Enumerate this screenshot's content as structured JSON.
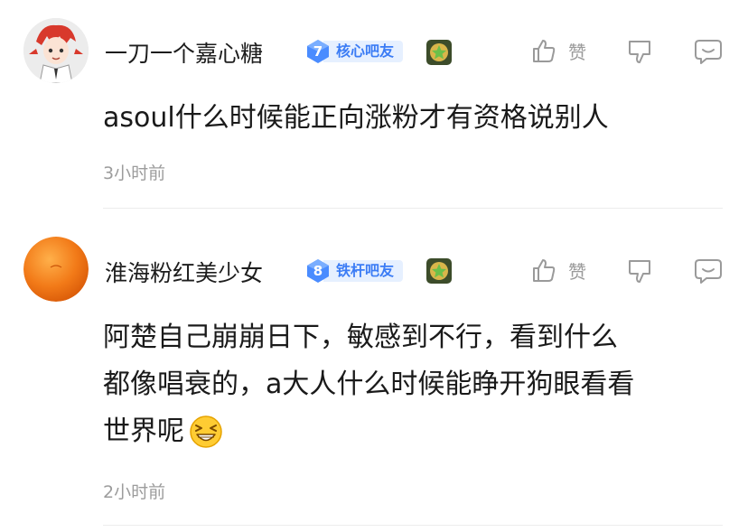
{
  "comments": [
    {
      "username": "一刀一个嘉心糖",
      "level": "7",
      "badge_title": "核心吧友",
      "text": "asoul什么时候能正向涨粉才有资格说别人",
      "time": "3小时前",
      "like_label": "赞"
    },
    {
      "username": "淮海粉红美少女",
      "level": "8",
      "badge_title": "铁杆吧友",
      "text_line1": "阿楚自己崩崩日下，敏感到不行，看到什么",
      "text_line2": "都像唱衰的，a大人什么时候能睁开狗眼看看",
      "text_line3": "世界呢",
      "time": "2小时前",
      "like_label": "赞"
    }
  ],
  "colors": {
    "badge_blue": "#3b7cf5",
    "badge_bg": "#e6f0ff",
    "meta_gray": "#9c9c9c",
    "orange_avatar": "#f07a1a"
  },
  "icons": [
    "avatar-anime",
    "avatar-orange",
    "level-gem-icon",
    "medal-icon",
    "thumbs-up-icon",
    "thumbs-down-icon",
    "reply-bubble-icon",
    "grinning-squint-emoji-icon"
  ]
}
